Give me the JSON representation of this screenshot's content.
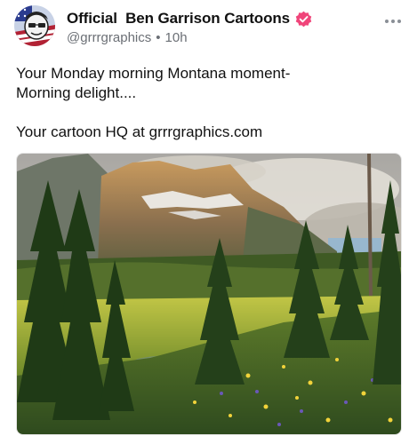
{
  "post": {
    "author": {
      "display_name": "Official  Ben Garrison Cartoons",
      "handle": "@grrrgraphics",
      "separator": "•",
      "time": "10h",
      "verified_color": "#f0457a"
    },
    "text_lines": [
      "Your Monday morning Montana moment-",
      "Morning delight....",
      "Your cartoon HQ at grrrgraphics.com"
    ],
    "more_icon": "more-horizontal-icon",
    "image": {
      "subject": "mountain meadow landscape photo"
    }
  }
}
